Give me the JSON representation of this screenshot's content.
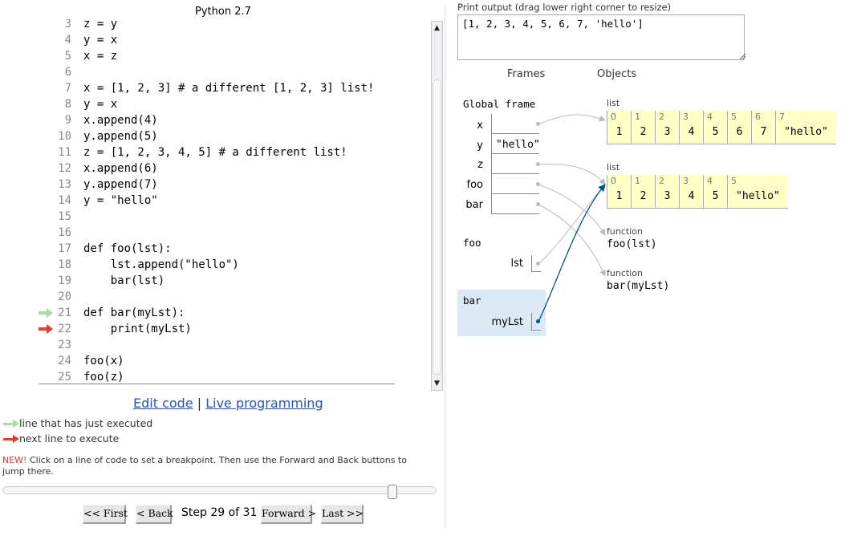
{
  "language": "Python 2.7",
  "code_lines": [
    {
      "num": "3",
      "text": "z = y",
      "marker": ""
    },
    {
      "num": "4",
      "text": "y = x",
      "marker": ""
    },
    {
      "num": "5",
      "text": "x = z",
      "marker": ""
    },
    {
      "num": "6",
      "text": "",
      "marker": ""
    },
    {
      "num": "7",
      "text": "x = [1, 2, 3] # a different [1, 2, 3] list!",
      "marker": ""
    },
    {
      "num": "8",
      "text": "y = x",
      "marker": ""
    },
    {
      "num": "9",
      "text": "x.append(4)",
      "marker": ""
    },
    {
      "num": "10",
      "text": "y.append(5)",
      "marker": ""
    },
    {
      "num": "11",
      "text": "z = [1, 2, 3, 4, 5] # a different list!",
      "marker": ""
    },
    {
      "num": "12",
      "text": "x.append(6)",
      "marker": ""
    },
    {
      "num": "13",
      "text": "y.append(7)",
      "marker": ""
    },
    {
      "num": "14",
      "text": "y = \"hello\"",
      "marker": ""
    },
    {
      "num": "15",
      "text": "",
      "marker": ""
    },
    {
      "num": "16",
      "text": "",
      "marker": ""
    },
    {
      "num": "17",
      "text": "def foo(lst):",
      "marker": ""
    },
    {
      "num": "18",
      "text": "    lst.append(\"hello\")",
      "marker": ""
    },
    {
      "num": "19",
      "text": "    bar(lst)",
      "marker": ""
    },
    {
      "num": "20",
      "text": "",
      "marker": ""
    },
    {
      "num": "21",
      "text": "def bar(myLst):",
      "marker": "green"
    },
    {
      "num": "22",
      "text": "    print(myLst)",
      "marker": "red"
    },
    {
      "num": "23",
      "text": "",
      "marker": ""
    },
    {
      "num": "24",
      "text": "foo(x)",
      "marker": ""
    },
    {
      "num": "25",
      "text": "foo(z)",
      "marker": ""
    }
  ],
  "links": {
    "edit": "Edit code",
    "separator": " | ",
    "live": "Live programming"
  },
  "legend": {
    "executed": "line that has just executed",
    "next": "next line to execute"
  },
  "note": {
    "new": "NEW!",
    "text": " Click on a line of code to set a breakpoint. Then use the Forward and Back buttons to jump there."
  },
  "slider": {
    "step": 29,
    "total": 31
  },
  "nav": {
    "first": "<< First",
    "back": "< Back",
    "step_label": "Step 29 of 31",
    "forward": "Forward >",
    "last": "Last >>"
  },
  "output": {
    "label": "Print output (drag lower right corner to resize)",
    "text": "[1, 2, 3, 4, 5, 6, 7, 'hello']"
  },
  "viz": {
    "frames_header": "Frames",
    "objects_header": "Objects",
    "global_frame": {
      "title": "Global frame",
      "vars": [
        {
          "name": "x",
          "value": ""
        },
        {
          "name": "y",
          "value": "\"hello\""
        },
        {
          "name": "z",
          "value": ""
        },
        {
          "name": "foo",
          "value": ""
        },
        {
          "name": "bar",
          "value": ""
        }
      ]
    },
    "foo_frame": {
      "title": "foo",
      "vars": [
        {
          "name": "lst",
          "value": ""
        }
      ]
    },
    "bar_frame": {
      "title": "bar",
      "vars": [
        {
          "name": "myLst",
          "value": ""
        }
      ]
    },
    "list1": {
      "type": "list",
      "items": [
        {
          "idx": "0",
          "val": "1"
        },
        {
          "idx": "1",
          "val": "2"
        },
        {
          "idx": "2",
          "val": "3"
        },
        {
          "idx": "3",
          "val": "4"
        },
        {
          "idx": "4",
          "val": "5"
        },
        {
          "idx": "5",
          "val": "6"
        },
        {
          "idx": "6",
          "val": "7"
        },
        {
          "idx": "7",
          "val": "\"hello\""
        }
      ]
    },
    "list2": {
      "type": "list",
      "items": [
        {
          "idx": "0",
          "val": "1"
        },
        {
          "idx": "1",
          "val": "2"
        },
        {
          "idx": "2",
          "val": "3"
        },
        {
          "idx": "3",
          "val": "4"
        },
        {
          "idx": "4",
          "val": "5"
        },
        {
          "idx": "5",
          "val": "\"hello\""
        }
      ]
    },
    "func_foo": {
      "type": "function",
      "name": "foo(lst)"
    },
    "func_bar": {
      "type": "function",
      "name": "bar(myLst)"
    }
  },
  "colors": {
    "green_arrow": "#a8dca5",
    "red_arrow": "#e43b2f",
    "link": "#2a56a8",
    "heap_bg": "#ffffc6",
    "highlight_frame": "#dbe8f5",
    "pointer_active": "#005583",
    "pointer_inactive": "#bbbbbb"
  }
}
